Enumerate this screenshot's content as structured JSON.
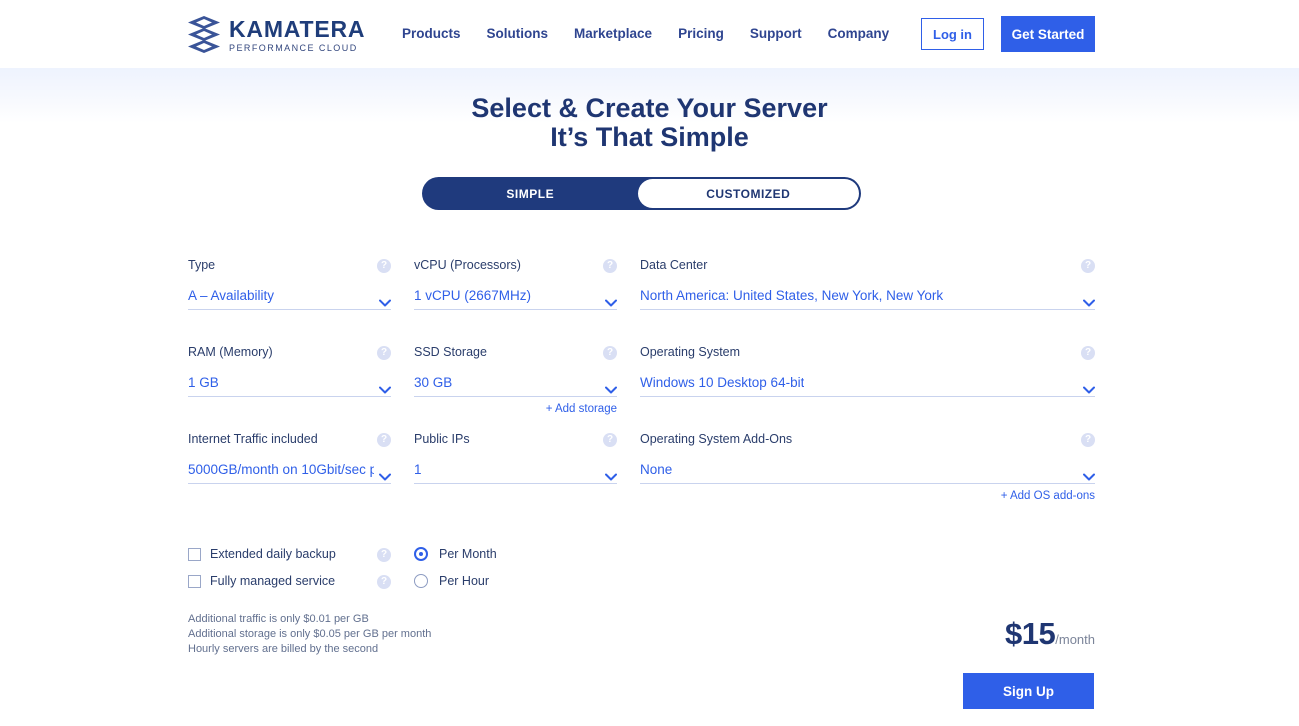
{
  "header": {
    "logo": {
      "title": "KAMATERA",
      "subtitle": "PERFORMANCE CLOUD"
    },
    "nav": [
      {
        "label": "Products"
      },
      {
        "label": "Solutions"
      },
      {
        "label": "Marketplace"
      },
      {
        "label": "Pricing"
      },
      {
        "label": "Support"
      },
      {
        "label": "Company"
      }
    ],
    "login_label": "Log in",
    "get_started_label": "Get Started"
  },
  "hero": {
    "title_line1": "Select & Create Your Server",
    "title_line2": "It’s That Simple",
    "toggle": {
      "simple": "SIMPLE",
      "customized": "CUSTOMIZED",
      "active": "SIMPLE"
    }
  },
  "form": {
    "help_glyph": "?",
    "fields": [
      {
        "key": "type",
        "label": "Type",
        "value": "A – Availability"
      },
      {
        "key": "vcpu",
        "label": "vCPU (Processors)",
        "value": "1 vCPU (2667MHz)"
      },
      {
        "key": "dc",
        "label": "Data Center",
        "value": "North America: United States, New York, New York"
      },
      {
        "key": "ram",
        "label": "RAM (Memory)",
        "value": "1 GB"
      },
      {
        "key": "ssd",
        "label": "SSD Storage",
        "value": "30 GB"
      },
      {
        "key": "os",
        "label": "Operating System",
        "value": "Windows 10 Desktop 64-bit"
      },
      {
        "key": "traffic",
        "label": "Internet Traffic included",
        "value": "5000GB/month on 10Gbit/sec p"
      },
      {
        "key": "ips",
        "label": "Public IPs",
        "value": "1"
      },
      {
        "key": "addons",
        "label": "Operating System Add-Ons",
        "value": "None"
      }
    ],
    "add_storage_link": "+ Add storage",
    "add_osaddons_link": "+ Add OS add-ons"
  },
  "options": {
    "checkboxes": [
      {
        "label": "Extended daily backup",
        "checked": false
      },
      {
        "label": "Fully managed service",
        "checked": false
      }
    ],
    "billing": [
      {
        "label": "Per Month",
        "selected": true
      },
      {
        "label": "Per Hour",
        "selected": false
      }
    ]
  },
  "notes": [
    "Additional traffic is only $0.01 per GB",
    "Additional storage is only $0.05 per GB per month",
    "Hourly servers are billed by the second"
  ],
  "price": {
    "amount": "$15",
    "period": "/month"
  },
  "signup_label": "Sign Up",
  "colors": {
    "brand_navy": "#1f3672",
    "accent_blue": "#2f5fe8",
    "toggle_bg": "#1f3a7d",
    "help_circle": "#d9dff4",
    "underline": "#c9d3ee"
  }
}
